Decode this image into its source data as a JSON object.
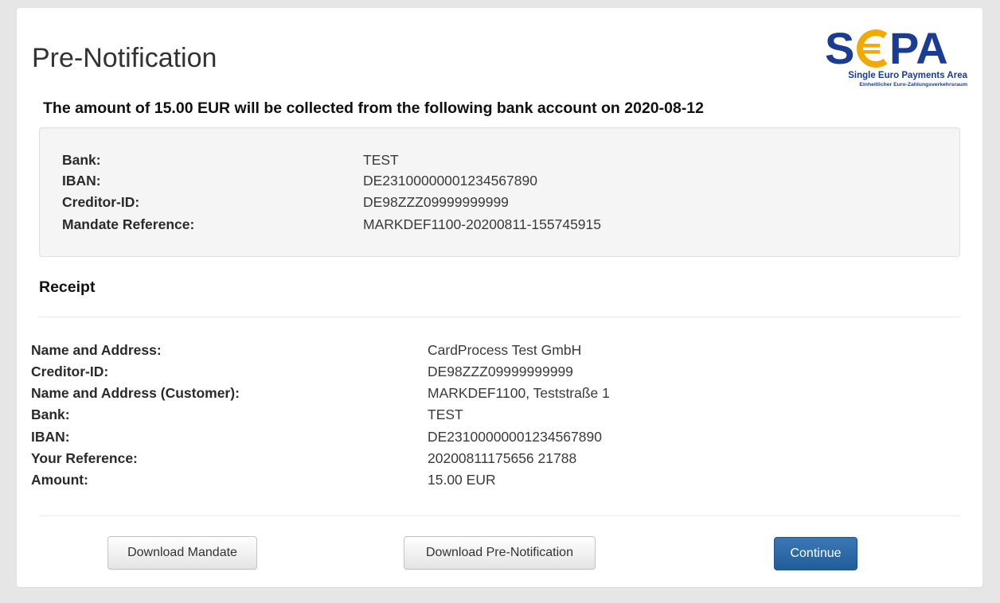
{
  "page": {
    "title": "Pre-Notification",
    "headline": "The amount of 15.00 EUR will be collected from the following bank account on 2020-08-12"
  },
  "logo": {
    "text": "SEPA",
    "tagline": "Single Euro Payments Area",
    "subtagline": "Einheitlicher Euro-Zahlungsverkehrsraum",
    "colors": {
      "blue": "#1b3c93",
      "gold": "#f2a900"
    }
  },
  "account": {
    "rows": [
      {
        "label": "Bank:",
        "value": "TEST"
      },
      {
        "label": "IBAN:",
        "value": "DE23100000001234567890"
      },
      {
        "label": "Creditor-ID:",
        "value": "DE98ZZZ09999999999"
      },
      {
        "label": "Mandate Reference:",
        "value": "MARKDEF1100-20200811-155745915"
      }
    ]
  },
  "receipt": {
    "title": "Receipt",
    "rows": [
      {
        "label": "Name and Address:",
        "value": "CardProcess Test GmbH"
      },
      {
        "label": "Creditor-ID:",
        "value": "DE98ZZZ09999999999"
      },
      {
        "label": "Name and Address (Customer):",
        "value": "MARKDEF1100, Teststraße 1"
      },
      {
        "label": "Bank:",
        "value": "TEST"
      },
      {
        "label": "IBAN:",
        "value": "DE23100000001234567890"
      },
      {
        "label": "Your Reference:",
        "value": "20200811175656 21788"
      },
      {
        "label": "Amount:",
        "value": "15.00 EUR"
      }
    ]
  },
  "actions": {
    "download_mandate": "Download Mandate",
    "download_prenotification": "Download Pre-Notification",
    "continue": "Continue"
  },
  "colors": {
    "primary": "#2a6aa8",
    "background": "#e6e6e6",
    "panel": "#f5f5f5"
  }
}
